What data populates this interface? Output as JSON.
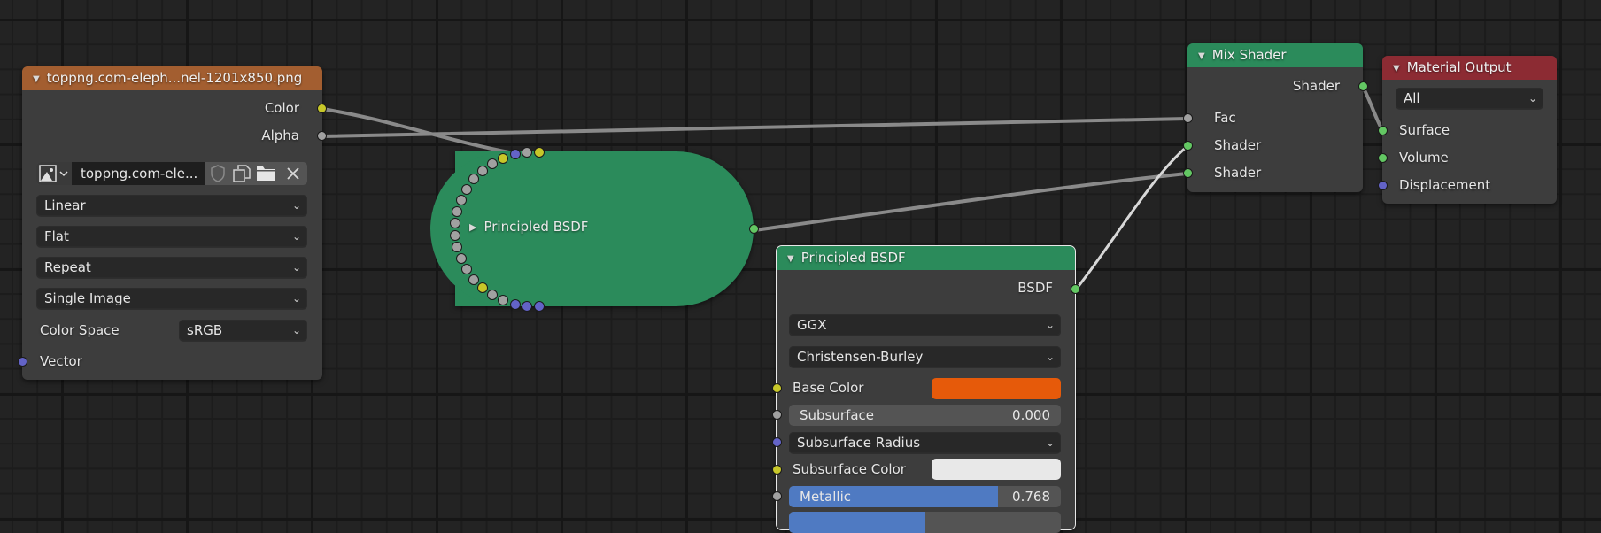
{
  "colors": {
    "background": "#232323",
    "node_body": "#3d3d3d",
    "header_texture": "#a35e30",
    "header_shader": "#2b8b5b",
    "header_output": "#8c2b33",
    "socket_color": "#c7c729",
    "socket_float": "#a1a1a1",
    "socket_vector": "#6363c7",
    "socket_shader": "#63c763",
    "slider_fill": "#4f7ac2",
    "base_color": "#e65a0a",
    "subsurface_color": "#e8e8e8"
  },
  "image_texture_node": {
    "title": "toppng.com-eleph...nel-1201x850.png",
    "outputs": [
      "Color",
      "Alpha"
    ],
    "image_field": "toppng.com-ele...",
    "image_icons": [
      "image-browse-icon",
      "fake-user-shield-icon",
      "duplicate-icon",
      "open-folder-icon",
      "unlink-x-icon"
    ],
    "interpolation": "Linear",
    "projection": "Flat",
    "extension": "Repeat",
    "source": "Single Image",
    "color_space_label": "Color Space",
    "color_space": "sRGB",
    "inputs": [
      "Vector"
    ]
  },
  "collapsed_node": {
    "title": "Principled BSDF",
    "socket_types": [
      "color",
      "float",
      "vector",
      "color",
      "float",
      "float",
      "float",
      "float",
      "float",
      "float",
      "float",
      "float",
      "float",
      "float",
      "float",
      "float",
      "color",
      "float",
      "float",
      "vector",
      "vector",
      "vector"
    ]
  },
  "principled_node": {
    "title": "Principled BSDF",
    "output": "BSDF",
    "distribution": "GGX",
    "subsurface_method": "Christensen-Burley",
    "fields": [
      {
        "label": "Base Color",
        "type": "color"
      },
      {
        "label": "Subsurface",
        "type": "slider",
        "value": "0.000",
        "fraction": 0.0
      },
      {
        "label": "Subsurface Radius",
        "type": "dropdown"
      },
      {
        "label": "Subsurface Color",
        "type": "color"
      },
      {
        "label": "Metallic",
        "type": "slider",
        "value": "0.768",
        "fraction": 0.768
      },
      {
        "label": "",
        "type": "slider",
        "value": "",
        "fraction": 0.5
      }
    ]
  },
  "mix_shader_node": {
    "title": "Mix Shader",
    "output": "Shader",
    "inputs": [
      "Fac",
      "Shader",
      "Shader"
    ]
  },
  "material_output_node": {
    "title": "Material Output",
    "target": "All",
    "inputs": [
      "Surface",
      "Volume",
      "Displacement"
    ]
  }
}
